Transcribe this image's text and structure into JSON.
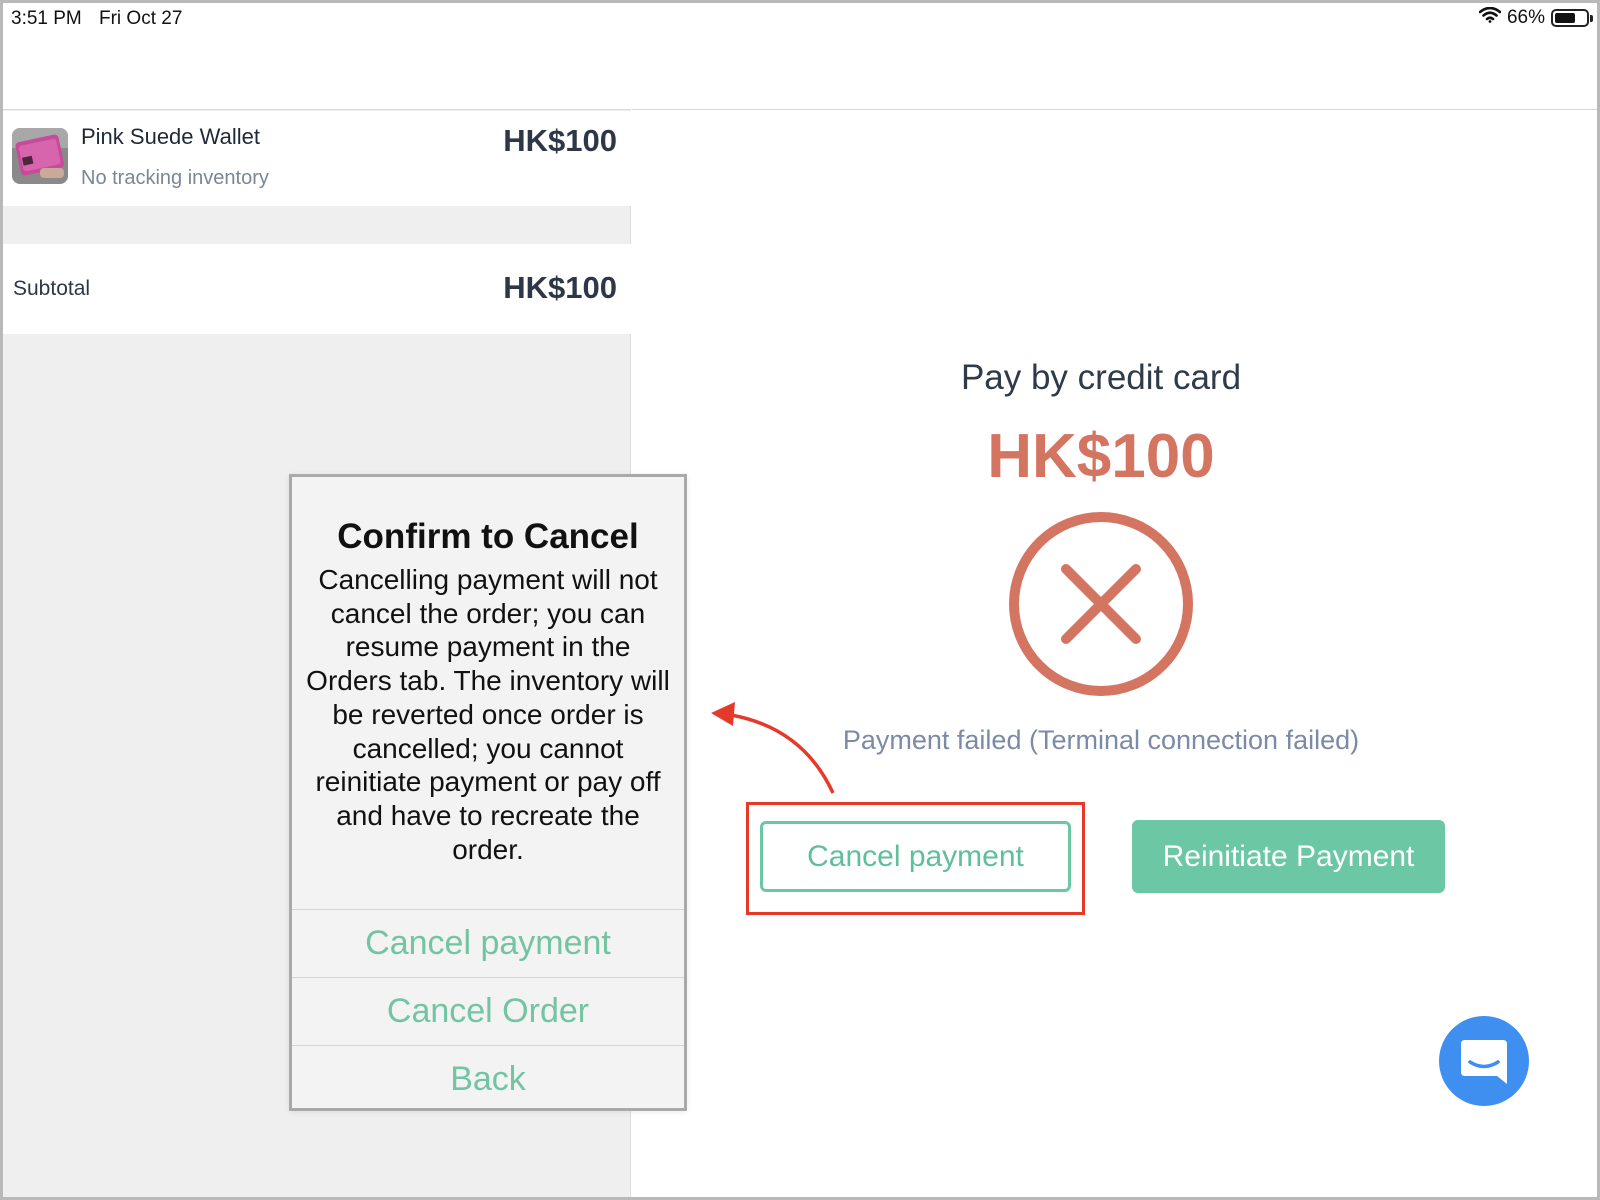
{
  "status_bar": {
    "time": "3:51 PM",
    "date": "Fri Oct 27",
    "battery": "66%",
    "battery_level": 0.66
  },
  "cart": {
    "item": {
      "name": "Pink Suede Wallet",
      "subtitle": "No tracking inventory",
      "price": "HK$100"
    },
    "subtotal_label": "Subtotal",
    "subtotal_value": "HK$100"
  },
  "payment": {
    "title": "Pay by credit card",
    "amount": "HK$100",
    "status_text": "Payment failed (Terminal connection failed)",
    "cancel_button": "Cancel payment",
    "reinitiate_button": "Reinitiate Payment"
  },
  "dialog": {
    "title": "Confirm to Cancel",
    "body": "Cancelling payment will not cancel the order; you can resume payment in the Orders tab. The inventory will be reverted once order is cancelled; you cannot reinitiate payment or pay off and have to recreate the order.",
    "buttons": {
      "cancel_payment": "Cancel payment",
      "cancel_order": "Cancel Order",
      "back": "Back"
    }
  },
  "colors": {
    "accent_green": "#6cc7a5",
    "error_red": "#d47562",
    "highlight_red": "#e53a2a",
    "chat_blue": "#3e8ff0"
  },
  "icons": {
    "failure": "x-circle-icon",
    "chat": "chat-bubble-icon",
    "wifi": "wifi-icon",
    "battery": "battery-icon",
    "product": "wallet-thumbnail"
  }
}
